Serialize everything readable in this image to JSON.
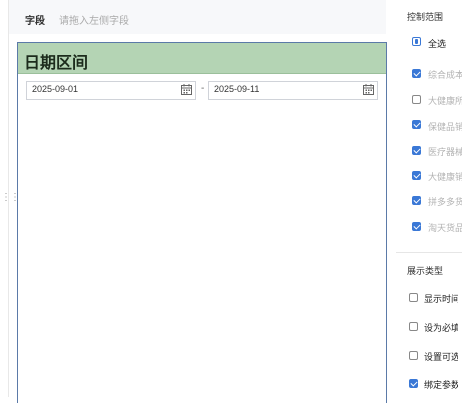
{
  "field_bar": {
    "label": "字段",
    "placeholder": "请拖入左侧字段"
  },
  "card": {
    "title": "日期区间",
    "start_date": "2025-09-01",
    "separator": "-",
    "end_date": "2025-09-11"
  },
  "control_range": {
    "title": "控制范围",
    "select_all": {
      "label": "全选",
      "state": "partial"
    },
    "items": [
      {
        "label": "综合成本",
        "checked": true
      },
      {
        "label": "大健康所",
        "checked": false
      },
      {
        "label": "保健品销",
        "checked": true
      },
      {
        "label": "医疗器械",
        "checked": true
      },
      {
        "label": "大健康销",
        "checked": true
      },
      {
        "label": "拼多多货",
        "checked": true
      },
      {
        "label": "淘天货品",
        "checked": true
      }
    ]
  },
  "display_type": {
    "title": "展示类型",
    "options": [
      {
        "label": "显示时间",
        "checked": false
      },
      {
        "label": "设为必填",
        "checked": false
      },
      {
        "label": "设置可选",
        "checked": false
      },
      {
        "label": "绑定参数",
        "checked": true
      }
    ]
  },
  "colors": {
    "accent": "#3a78d6",
    "card_header": "#b4d4b4",
    "card_border": "#5b7aa8"
  }
}
